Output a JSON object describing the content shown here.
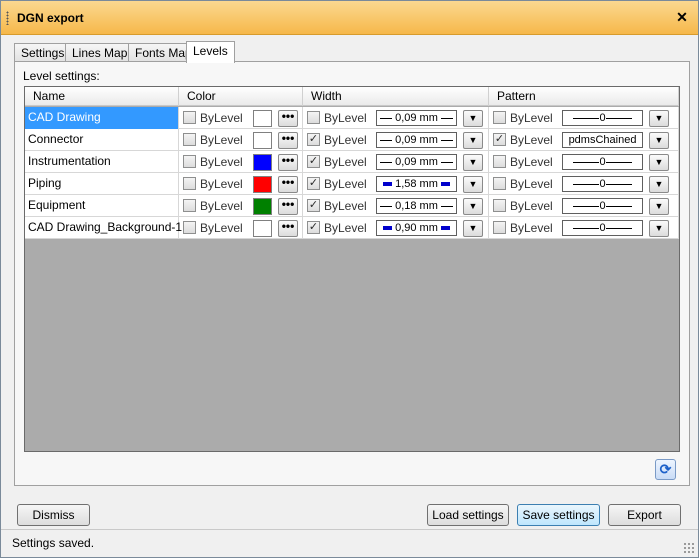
{
  "window": {
    "title": "DGN export",
    "close_glyph": "✕"
  },
  "tabs": [
    {
      "label": "Settings",
      "active": false
    },
    {
      "label": "Lines Map",
      "active": false
    },
    {
      "label": "Fonts Map",
      "active": false
    },
    {
      "label": "Levels",
      "active": true
    }
  ],
  "levels": {
    "section_label": "Level settings:",
    "columns": {
      "name": "Name",
      "color": "Color",
      "width": "Width",
      "pattern": "Pattern"
    },
    "bylevel_label": "ByLevel",
    "dots_label": "•••",
    "dropdown_glyph": "▼",
    "rows": [
      {
        "name": "CAD Drawing",
        "selected": true,
        "color_bylevel": false,
        "color": "#ffffff",
        "width_bylevel": false,
        "width_value": "0,09 mm",
        "width_thick": false,
        "pattern_bylevel": false,
        "pattern_value": "0",
        "pattern_is_line": true
      },
      {
        "name": "Connector",
        "selected": false,
        "color_bylevel": false,
        "color": "#ffffff",
        "width_bylevel": true,
        "width_value": "0,09 mm",
        "width_thick": false,
        "pattern_bylevel": true,
        "pattern_value": "pdmsChained",
        "pattern_is_line": false
      },
      {
        "name": "Instrumentation",
        "selected": false,
        "color_bylevel": false,
        "color": "#0000ff",
        "width_bylevel": true,
        "width_value": "0,09 mm",
        "width_thick": false,
        "pattern_bylevel": false,
        "pattern_value": "0",
        "pattern_is_line": true
      },
      {
        "name": "Piping",
        "selected": false,
        "color_bylevel": false,
        "color": "#ff0000",
        "width_bylevel": true,
        "width_value": "1,58 mm",
        "width_thick": true,
        "pattern_bylevel": false,
        "pattern_value": "0",
        "pattern_is_line": true
      },
      {
        "name": "Equipment",
        "selected": false,
        "color_bylevel": false,
        "color": "#008000",
        "width_bylevel": true,
        "width_value": "0,18 mm",
        "width_thick": false,
        "pattern_bylevel": false,
        "pattern_value": "0",
        "pattern_is_line": true
      },
      {
        "name": "CAD Drawing_Background-1",
        "selected": false,
        "color_bylevel": false,
        "color": "#ffffff",
        "width_bylevel": true,
        "width_value": "0,90 mm",
        "width_thick": true,
        "pattern_bylevel": false,
        "pattern_value": "0",
        "pattern_is_line": true
      }
    ]
  },
  "refresh_icon": "refresh-icon",
  "refresh_glyph": "⟳",
  "buttons": {
    "dismiss": "Dismiss",
    "load": "Load settings",
    "save": "Save settings",
    "export": "Export"
  },
  "status": "Settings saved.",
  "colors": {
    "titlebar": "#f6b84a",
    "selection": "#3399ff",
    "grid_background": "#ababab",
    "width_line_blue": "#0000cc"
  }
}
